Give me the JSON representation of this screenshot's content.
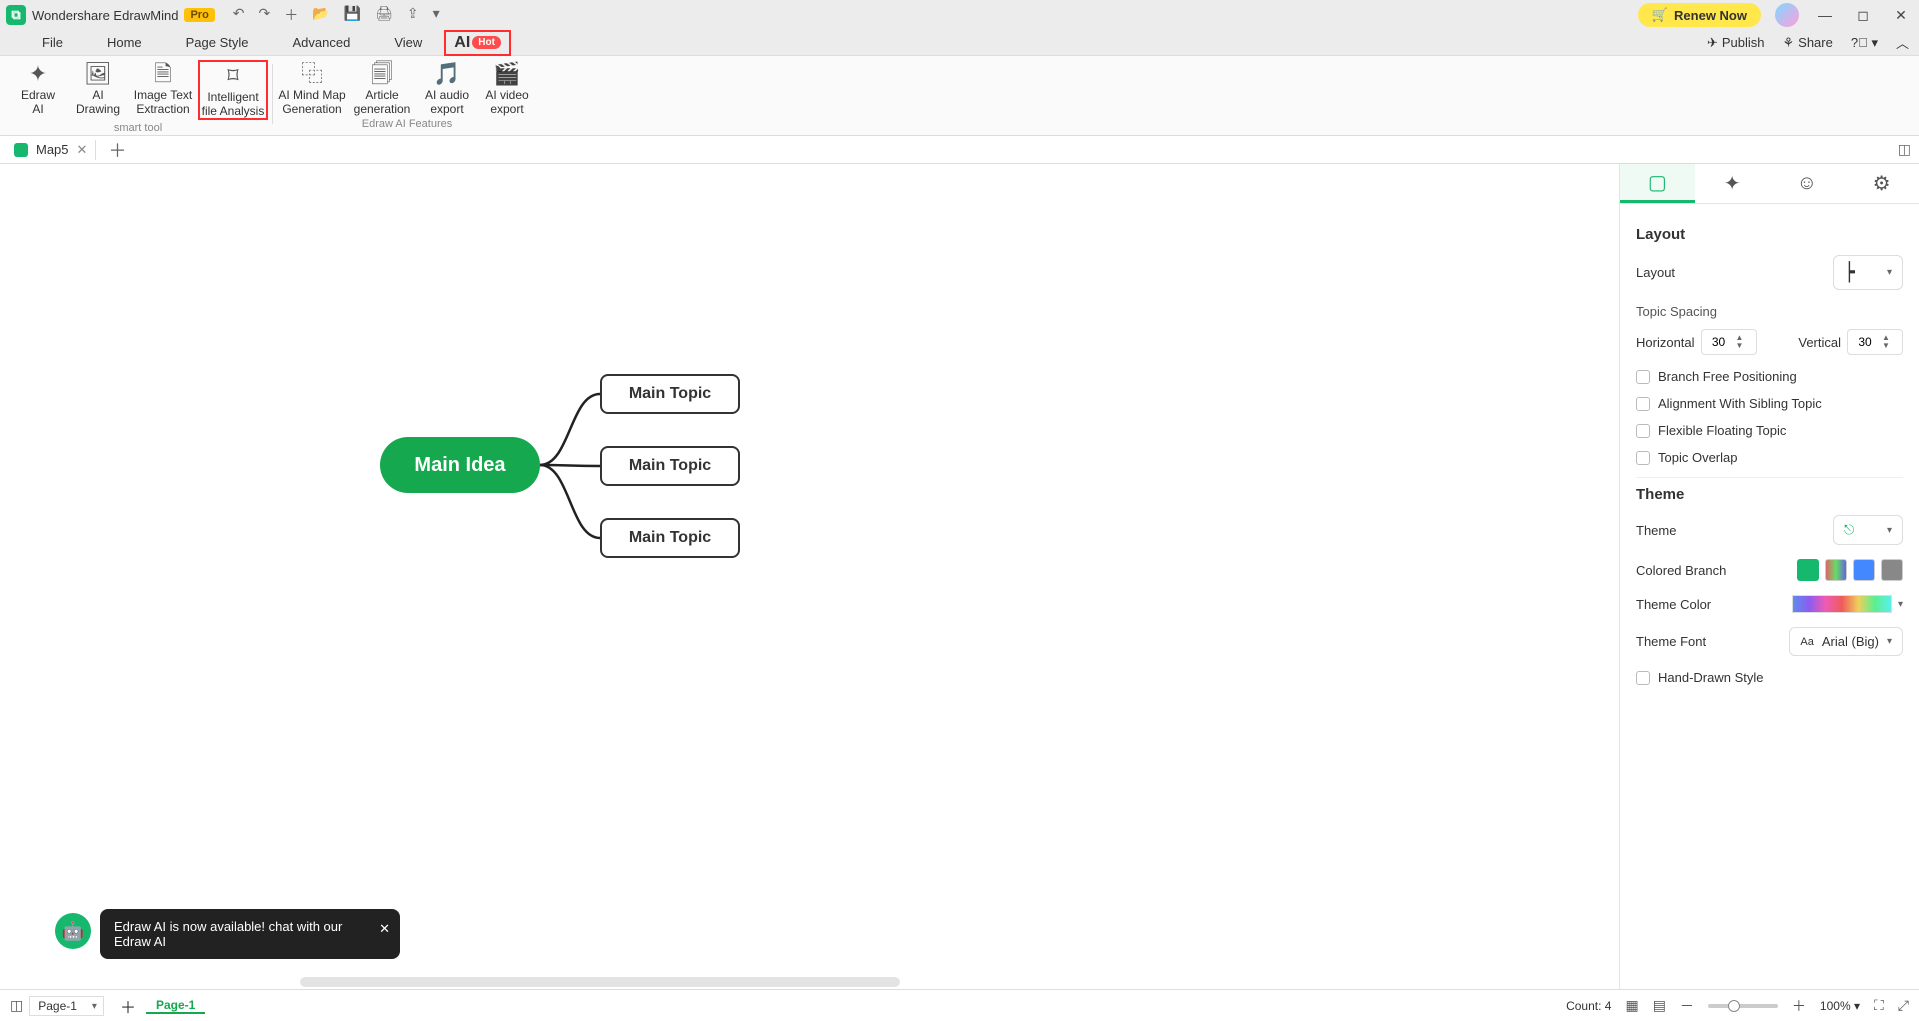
{
  "titlebar": {
    "app_name": "Wondershare EdrawMind",
    "badge": "Pro",
    "renew": "Renew Now"
  },
  "menu": {
    "items": [
      "File",
      "Home",
      "Page Style",
      "Advanced",
      "View"
    ],
    "ai_label": "AI",
    "ai_badge": "Hot",
    "publish": "Publish",
    "share": "Share"
  },
  "ribbon": {
    "btns": [
      {
        "l1": "Edraw",
        "l2": "AI"
      },
      {
        "l1": "AI",
        "l2": "Drawing"
      },
      {
        "l1": "Image Text",
        "l2": "Extraction"
      },
      {
        "l1": "Intelligent",
        "l2": "file Analysis"
      },
      {
        "l1": "AI Mind Map",
        "l2": "Generation"
      },
      {
        "l1": "Article",
        "l2": "generation"
      },
      {
        "l1": "AI audio",
        "l2": "export"
      },
      {
        "l1": "AI video",
        "l2": "export"
      }
    ],
    "grp1": "smart tool",
    "grp2": "Edraw AI Features"
  },
  "tabs": {
    "doc": "Map5"
  },
  "mindmap": {
    "root": "Main Idea",
    "topics": [
      "Main Topic",
      "Main Topic",
      "Main Topic"
    ]
  },
  "toast": {
    "text": "Edraw AI is now available!  chat with our Edraw AI"
  },
  "side": {
    "layout_h": "Layout",
    "layout_l": "Layout",
    "spacing": "Topic Spacing",
    "horiz": "Horizontal",
    "horiz_v": "30",
    "vert": "Vertical",
    "vert_v": "30",
    "chk1": "Branch Free Positioning",
    "chk2": "Alignment With Sibling Topic",
    "chk3": "Flexible Floating Topic",
    "chk4": "Topic Overlap",
    "theme_h": "Theme",
    "theme_l": "Theme",
    "colbranch": "Colored Branch",
    "themecolor": "Theme Color",
    "themefont_l": "Theme Font",
    "themefont_v": "Arial (Big)",
    "handdrawn": "Hand-Drawn Style"
  },
  "status": {
    "page_dd": "Page-1",
    "page_btn": "Page-1",
    "count": "Count: 4",
    "zoom": "100%"
  }
}
